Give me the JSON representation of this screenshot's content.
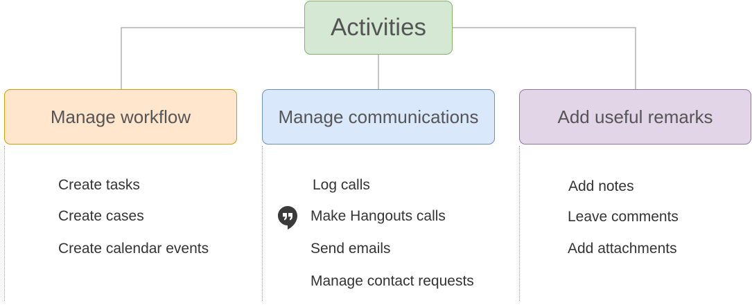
{
  "root": {
    "label": "Activities",
    "color": "#d5e8d4"
  },
  "branches": [
    {
      "label": "Manage workflow",
      "color": "#ffe6cc",
      "items": [
        "Create tasks",
        "Create cases",
        "Create calendar events"
      ]
    },
    {
      "label": "Manage communications",
      "color": "#dae8fc",
      "items": [
        "Log calls",
        "Make Hangouts calls",
        "Send emails",
        "Manage contact requests"
      ]
    },
    {
      "label": "Add useful remarks",
      "color": "#e1d5e7",
      "items": [
        "Add notes",
        "Leave comments",
        "Add attachments"
      ]
    }
  ],
  "icons": {
    "hangouts": "hangouts-icon"
  }
}
